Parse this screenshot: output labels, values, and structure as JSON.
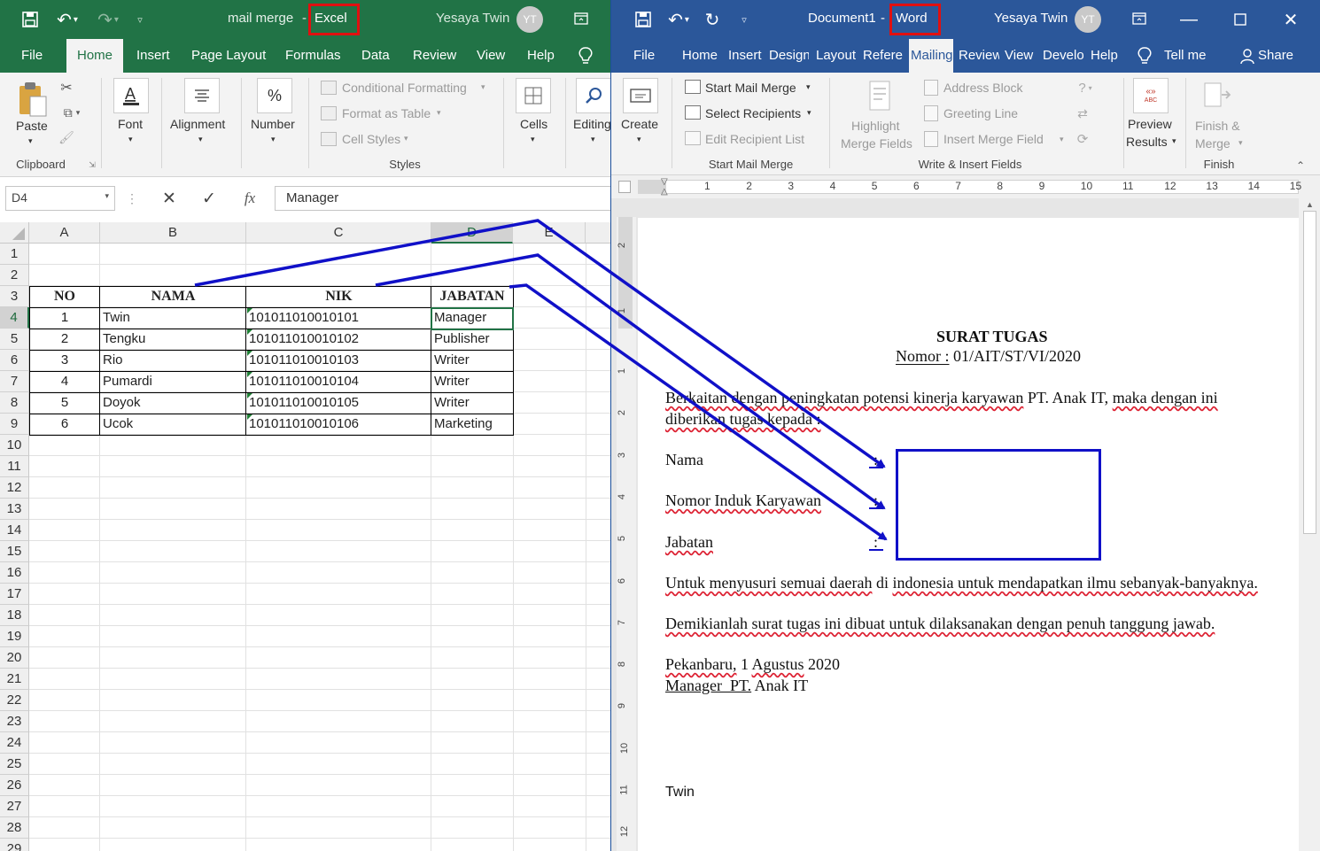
{
  "excel": {
    "qat_doc_name": "mail merge",
    "app_name": "Excel",
    "separator": "-",
    "user_name": "Yesaya Twin",
    "user_initials": "YT",
    "tabs": [
      "File",
      "Home",
      "Insert",
      "Page Layout",
      "Formulas",
      "Data",
      "Review",
      "View",
      "Help"
    ],
    "ribbon": {
      "paste": "Paste",
      "clipboard_group": "Clipboard",
      "font": "Font",
      "alignment": "Alignment",
      "number": "Number",
      "percent_glyph": "%",
      "conditional_formatting": "Conditional Formatting",
      "format_as_table": "Format as Table",
      "cell_styles": "Cell Styles",
      "styles_group": "Styles",
      "cells": "Cells",
      "editing": "Editing"
    },
    "name_box": "D4",
    "fx_label": "fx",
    "formula_value": "Manager",
    "columns": [
      "A",
      "B",
      "C",
      "D",
      "E"
    ],
    "row_numbers": [
      "1",
      "2",
      "3",
      "4",
      "5",
      "6",
      "7",
      "8",
      "9",
      "10",
      "11",
      "12",
      "13",
      "14",
      "15",
      "16",
      "17",
      "18",
      "19",
      "20",
      "21",
      "22",
      "23",
      "24",
      "25",
      "26",
      "27",
      "28",
      "29"
    ],
    "table_headers": [
      "NO",
      "NAMA",
      "NIK",
      "JABATAN"
    ],
    "table_rows": [
      [
        "1",
        "Twin",
        "101011010010101",
        "Manager"
      ],
      [
        "2",
        "Tengku",
        "101011010010102",
        "Publisher"
      ],
      [
        "3",
        "Rio",
        "101011010010103",
        "Writer"
      ],
      [
        "4",
        "Pumardi",
        "101011010010104",
        "Writer"
      ],
      [
        "5",
        "Doyok",
        "101011010010105",
        "Writer"
      ],
      [
        "6",
        "Ucok",
        "101011010010106",
        "Marketing"
      ]
    ]
  },
  "word": {
    "doc_name": "Document1",
    "app_name": "Word",
    "separator": "-",
    "user_name": "Yesaya Twin",
    "user_initials": "YT",
    "tabs": [
      "File",
      "Home",
      "Insert",
      "Design",
      "Layout",
      "References",
      "Mailings",
      "Review",
      "View",
      "Developer",
      "Help"
    ],
    "tell_me": "Tell me",
    "share": "Share",
    "ribbon": {
      "create": "Create",
      "start_mail_merge": "Start Mail Merge",
      "select_recipients": "Select Recipients",
      "edit_recipient_list": "Edit Recipient List",
      "start_group": "Start Mail Merge",
      "highlight_line1": "Highlight",
      "highlight_line2": "Merge Fields",
      "address_block": "Address Block",
      "greeting_line": "Greeting Line",
      "insert_merge_field": "Insert Merge Field",
      "write_group": "Write & Insert Fields",
      "preview_line1": "Preview",
      "preview_line2": "Results",
      "preview_badge": "ABC",
      "finish_line1": "Finish &",
      "finish_line2": "Merge",
      "finish_group": "Finish"
    },
    "ruler_numbers": [
      "1",
      "2",
      "3",
      "4",
      "5",
      "6",
      "7",
      "8",
      "9",
      "10",
      "11",
      "12",
      "13",
      "14",
      "15"
    ],
    "vruler_numbers": [
      "2",
      "1",
      "1",
      "2",
      "3",
      "4",
      "5",
      "6",
      "7",
      "8",
      "9",
      "10",
      "11",
      "12"
    ],
    "document": {
      "title": "SURAT TUGAS",
      "nomor_label": "Nomor :",
      "nomor_value": "01/AIT/ST/VI/2020",
      "intro_line1_a": "Berkaitan dengan peningkatan potensi kinerja karyawan",
      "intro_line1_b": "PT. Anak IT,",
      "intro_line1_c": "maka dengan ini",
      "intro_line2": "diberikan tugas kepada :",
      "field_nama": "Nama",
      "field_nik": "Nomor Induk Karyawan",
      "field_jabatan": "Jabatan",
      "colon": ":",
      "purpose_a": "Untuk menyusuri semuai daerah",
      "purpose_b": "di",
      "purpose_c": "indonesia untuk mendapatkan ilmu sebanyak-banyaknya.",
      "closing": "Demikianlah surat tugas ini dibuat untuk dilaksanakan dengan penuh tanggung jawab.",
      "place_date_a": "Pekanbaru,",
      "place_date_b": "1",
      "place_date_c": "Agustus",
      "place_date_d": "2020",
      "signer_title_a": "Manager  PT.",
      "signer_title_b": "Anak IT",
      "signer_name": "Twin"
    }
  },
  "annotation_colors": {
    "arrow": "#1010c8",
    "highlight_box": "#e01010"
  }
}
